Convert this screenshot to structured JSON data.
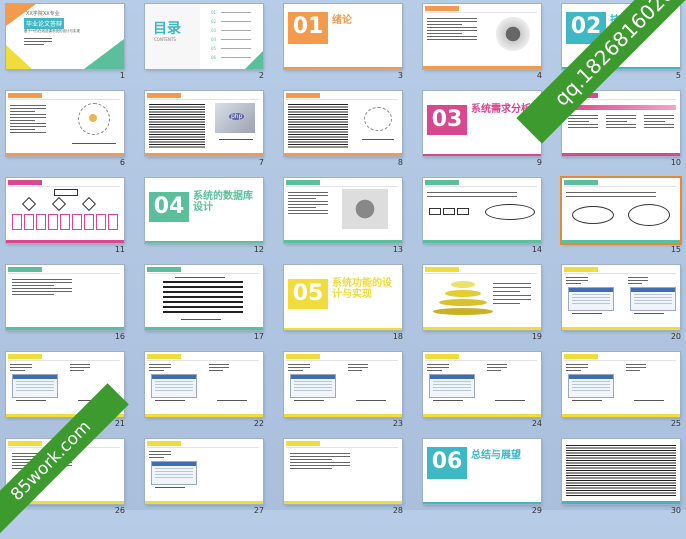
{
  "colors": {
    "background": "#b1c6e1",
    "green": "#5bbf9b",
    "orange": "#f39a4c",
    "magenta": "#d9478f",
    "yellow": "#f0dc3a",
    "teal": "#3fb8c6",
    "selected_border": "#e08a3c",
    "watermark": "#3c9a2e"
  },
  "watermarks": {
    "top_right": "qq.1826816020",
    "bottom_left": "85work.com"
  },
  "selected_slide": 15,
  "slides": [
    {
      "n": "1",
      "type": "cover",
      "line1": "XX学院XX专业",
      "line2": "毕业论文答辩",
      "line3": "基于**的在线选课系统的设计与实现"
    },
    {
      "n": "2",
      "type": "toc",
      "title": "目录",
      "sub": "CONTENTS",
      "items": [
        "01",
        "02",
        "03",
        "04",
        "05",
        "06"
      ]
    },
    {
      "n": "3",
      "type": "section",
      "num": "01",
      "title": "绪论",
      "accent": "orange"
    },
    {
      "n": "4",
      "type": "image",
      "accent": "orange",
      "icon": "meeting-people-icon"
    },
    {
      "n": "5",
      "type": "section",
      "num": "02",
      "title": "技术与",
      "accent": "teal"
    },
    {
      "n": "6",
      "type": "network",
      "accent": "orange"
    },
    {
      "n": "7",
      "type": "php",
      "accent": "orange",
      "php": "php"
    },
    {
      "n": "8",
      "type": "network-text",
      "accent": "orange"
    },
    {
      "n": "9",
      "type": "section",
      "num": "03",
      "title": "系统需求分析",
      "accent": "magenta"
    },
    {
      "n": "10",
      "type": "arrows",
      "accent": "magenta"
    },
    {
      "n": "11",
      "type": "flowchart",
      "accent": "magenta"
    },
    {
      "n": "12",
      "type": "section",
      "num": "04",
      "title": "系统的数据库设计",
      "accent": "green"
    },
    {
      "n": "13",
      "type": "database",
      "accent": "green",
      "icon": "database-icon"
    },
    {
      "n": "14",
      "type": "er",
      "accent": "green"
    },
    {
      "n": "15",
      "type": "er2",
      "accent": "green"
    },
    {
      "n": "16",
      "type": "text",
      "accent": "green"
    },
    {
      "n": "17",
      "type": "table",
      "accent": "green"
    },
    {
      "n": "18",
      "type": "section",
      "num": "05",
      "title": "系统功能的设计与实现",
      "accent": "yellow"
    },
    {
      "n": "19",
      "type": "pyramid",
      "accent": "yellow"
    },
    {
      "n": "20",
      "type": "screenshot",
      "accent": "yellow"
    },
    {
      "n": "21",
      "type": "screenshot",
      "accent": "yellow"
    },
    {
      "n": "22",
      "type": "screenshot",
      "accent": "yellow"
    },
    {
      "n": "23",
      "type": "screenshot",
      "accent": "yellow"
    },
    {
      "n": "24",
      "type": "screenshot",
      "accent": "yellow"
    },
    {
      "n": "25",
      "type": "screenshot",
      "accent": "yellow"
    },
    {
      "n": "26",
      "type": "text",
      "accent": "yellow"
    },
    {
      "n": "27",
      "type": "screenshot",
      "accent": "yellow"
    },
    {
      "n": "28",
      "type": "text",
      "accent": "yellow"
    },
    {
      "n": "29",
      "type": "section",
      "num": "06",
      "title": "总结与展望",
      "accent": "teal"
    },
    {
      "n": "30",
      "type": "dense",
      "accent": "teal"
    }
  ]
}
